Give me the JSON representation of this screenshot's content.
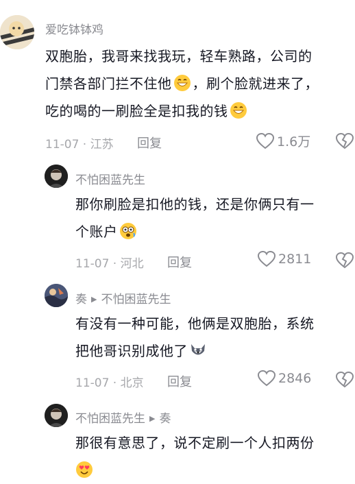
{
  "comments": [
    {
      "username": "爱吃钵钵鸡",
      "text_line1": "双胞胎，我哥来找我玩，轻车熟路，公司的",
      "text_line2a": "门禁各部门拦不住他",
      "text_line2b": "，刷个脸就进来了，",
      "text_line3": "吃的喝的一刷脸全是扣我的钱",
      "date_loc": "11-07 · 江苏",
      "reply_label": "回复",
      "likes": "1.6万"
    },
    {
      "username": "不怕困蓝先生",
      "text_line1": "那你刷脸是扣他的钱，还是你俩只有一",
      "text_line2": "个账户",
      "date_loc": "11-07 · 河北",
      "reply_label": "回复",
      "likes": "2811"
    },
    {
      "username": "奏",
      "reply_to": "不怕困蓝先生",
      "text_line1": "有没有一种可能，他俩是双胞胎，系统",
      "text_line2": "把他哥识别成他了",
      "date_loc": "11-07 · 北京",
      "reply_label": "回复",
      "likes": "2846"
    },
    {
      "username": "不怕困蓝先生",
      "reply_to": "奏",
      "text_line1": "那很有意思了，说不定刷一个人扣两份"
    }
  ],
  "icons": {
    "heart": "heart-outline-icon",
    "dislike": "broken-heart-icon",
    "emoji_grin": "grinning-emoji-icon",
    "emoji_dizzy": "dizzy-face-emoji-icon",
    "emoji_wolf": "wolf-emoji-icon",
    "emoji_hearts": "heart-eyes-emoji-icon"
  }
}
